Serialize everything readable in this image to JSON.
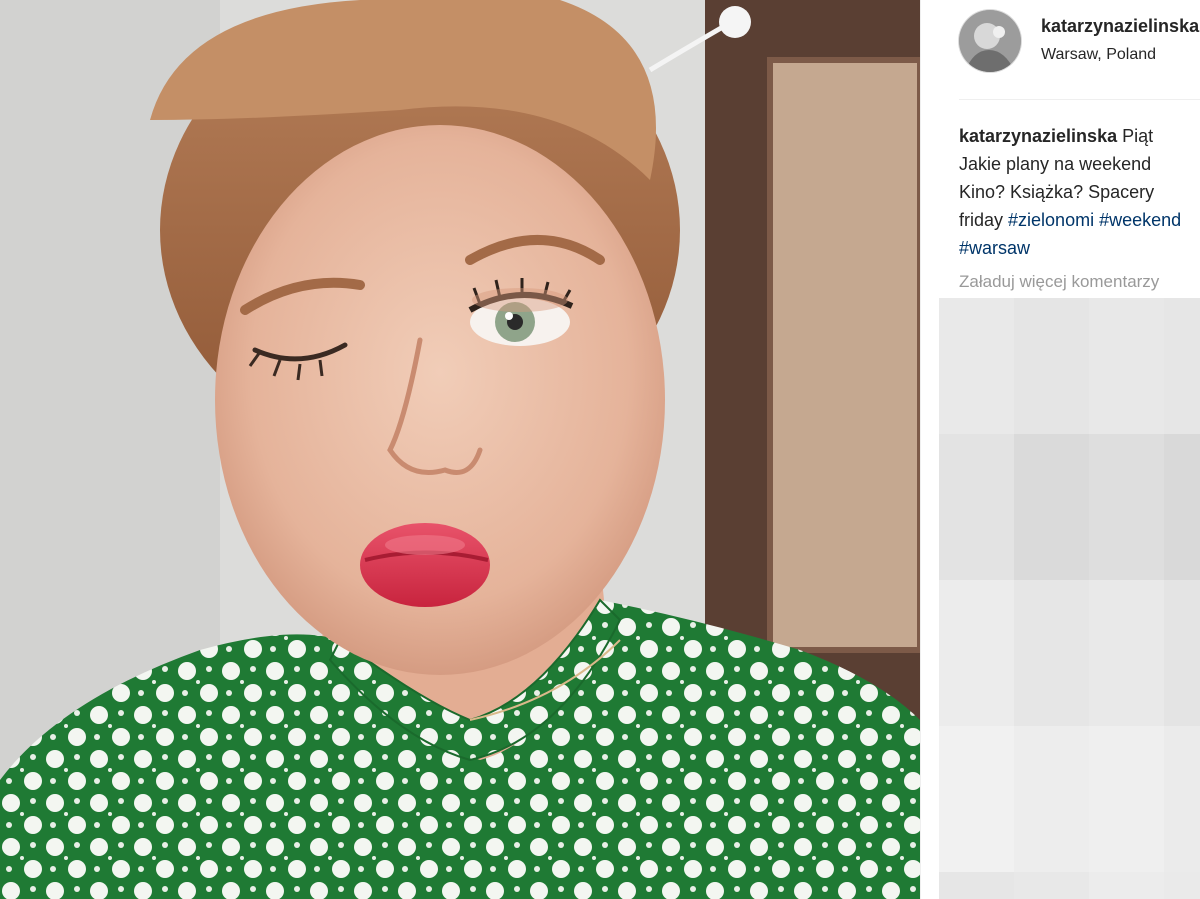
{
  "post": {
    "username": "katarzynazielinska",
    "location": "Warsaw, Poland"
  },
  "caption": {
    "author": "katarzynazielinska",
    "line1_rest": " Piąt",
    "line2": "Jakie plany na weekend",
    "line3": "Kino? Książka? Spacery",
    "line4_text": "friday ",
    "line4_tag1": "#zielonomi",
    "line4_space": " ",
    "line4_tag2": "#weekend",
    "line5_tag": "#warsaw"
  },
  "comments": {
    "load_more_label": "Załaduj więcej komentarzy"
  },
  "photo": {
    "subject": "selfie-woman-green-polka-dot-blouse"
  },
  "pixel_cells": [
    "#e9e9e9",
    "#e5e5e5",
    "#e8e8e8",
    "#e6e6e6",
    "#e3e3e3",
    "#dadada",
    "#dedede",
    "#d9d9d9",
    "#ececec",
    "#e6e6e6",
    "#e9e9e9",
    "#e4e4e4",
    "#f1f1f1",
    "#ededed",
    "#efefef",
    "#ebebeb",
    "#e6e6e6",
    "#e8e8e8",
    "#ececec",
    "#eaeaea"
  ],
  "colors": {
    "text": "#262626",
    "hashtag": "#003569",
    "muted": "#999999",
    "blouse_green": "#1f7a34"
  }
}
